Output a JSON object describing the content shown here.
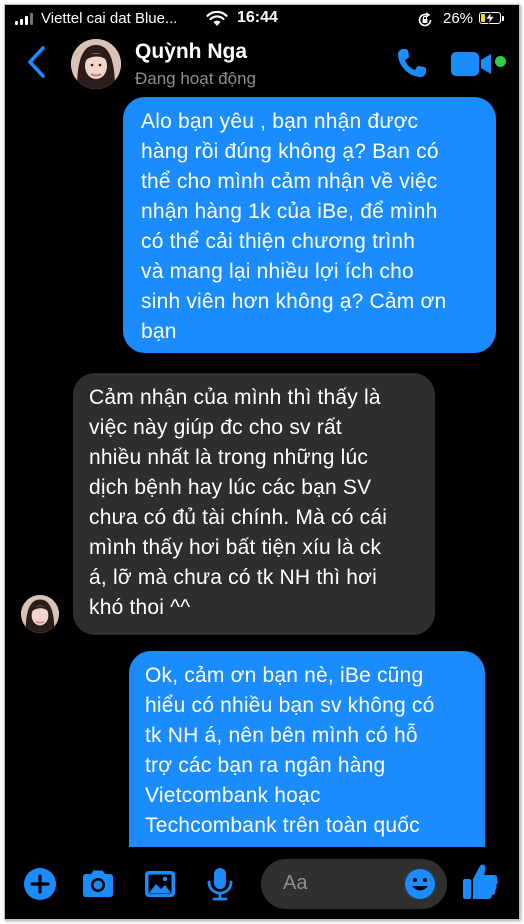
{
  "status_bar": {
    "carrier": "Viettel cai dat Blue...",
    "time": "16:44",
    "battery_percent": "26%",
    "battery_level": 0.26,
    "icons": [
      "signal-icon",
      "wifi-icon",
      "orientation-lock-icon",
      "battery-charging-icon"
    ]
  },
  "header": {
    "contact_name": "Quỳnh Nga",
    "contact_status": "Đang hoạt động",
    "icons": [
      "back-chevron-icon",
      "phone-icon",
      "video-camera-icon"
    ],
    "online_color": "#31cc46"
  },
  "messages": [
    {
      "direction": "sent",
      "lines": [
        "Alo bạn yêu , bạn nhận được",
        "hàng rồi đúng không ạ? Ban có",
        "thể cho mình cảm nhận về việc",
        "nhận hàng 1k của iBe, để mình",
        "có thể cải thiện chương trình",
        "và mang lại nhiều lợi ích cho",
        "sinh viên hơn không ạ? Cảm ơn",
        "bạn"
      ]
    },
    {
      "direction": "received",
      "lines": [
        "Cảm nhận của mình thì thấy là",
        "việc này giúp đc cho sv rất",
        "nhiều nhất là trong những lúc",
        "dịch bệnh hay lúc các bạn SV",
        "chưa có đủ tài chính. Mà có cái",
        "mình thấy hơi bất tiện xíu là ck",
        "á, lỡ mà chưa có tk NH thì hơi",
        "khó thoi ^^"
      ]
    },
    {
      "direction": "sent",
      "lines": [
        "Ok, cảm ơn bạn nè, iBe cũng",
        "hiểu có nhiều bạn sv không có",
        "tk NH á, nên bên mình có hỗ",
        "trợ các bạn ra ngân hàng",
        "Vietcombank hoạc",
        "Techcombank trên toàn quốc"
      ]
    }
  ],
  "composer": {
    "placeholder": "Aa",
    "icons": [
      "plus-circle-icon",
      "camera-icon",
      "image-icon",
      "microphone-icon",
      "emoji-icon",
      "thumbs-up-icon"
    ]
  },
  "colors": {
    "accent": "#1a8cfd",
    "sent_bubble": "#1a8cfd",
    "received_bubble": "#2e2e2e",
    "background": "#000000"
  }
}
